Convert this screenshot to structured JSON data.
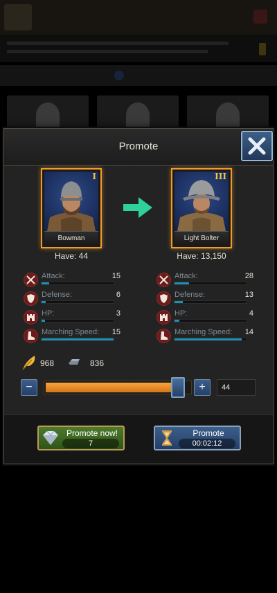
{
  "modal": {
    "title": "Promote"
  },
  "from_unit": {
    "name": "Bowman",
    "tier": "I",
    "have": "Have: 44",
    "stats": [
      {
        "label": "Attack:",
        "value": "15",
        "bar_fraction": 0.11,
        "icon": "swords-icon"
      },
      {
        "label": "Defense:",
        "value": "6",
        "bar_fraction": 0.06,
        "icon": "shield-icon"
      },
      {
        "label": "HP:",
        "value": "3",
        "bar_fraction": 0.05,
        "icon": "tower-icon"
      },
      {
        "label": "Marching Speed:",
        "value": "15",
        "bar_fraction": 1.0,
        "icon": "boot-icon"
      }
    ]
  },
  "to_unit": {
    "name": "Light Bolter",
    "tier": "III",
    "have": "Have: 13,150",
    "stats": [
      {
        "label": "Attack:",
        "value": "28",
        "bar_fraction": 0.2,
        "icon": "swords-icon"
      },
      {
        "label": "Defense:",
        "value": "13",
        "bar_fraction": 0.12,
        "icon": "shield-icon"
      },
      {
        "label": "HP:",
        "value": "4",
        "bar_fraction": 0.07,
        "icon": "tower-icon"
      },
      {
        "label": "Marching Speed:",
        "value": "14",
        "bar_fraction": 0.93,
        "icon": "boot-icon"
      }
    ]
  },
  "resources": {
    "feather": "968",
    "iron": "836"
  },
  "slider": {
    "minus_label": "−",
    "plus_label": "+",
    "fill_fraction": 0.98,
    "quantity": "44"
  },
  "buttons": {
    "promote_now_label": "Promote now!",
    "promote_now_cost": "7",
    "promote_label": "Promote",
    "promote_time": "00:02:12"
  },
  "colors": {
    "card_border": "#f29a2a",
    "stat_bar": "#1f8fb3",
    "slider_fill": "#e8891f",
    "arrow": "#2fd19a",
    "green_button": "#4c7a2c",
    "blue_button": "#3d5f8a"
  }
}
